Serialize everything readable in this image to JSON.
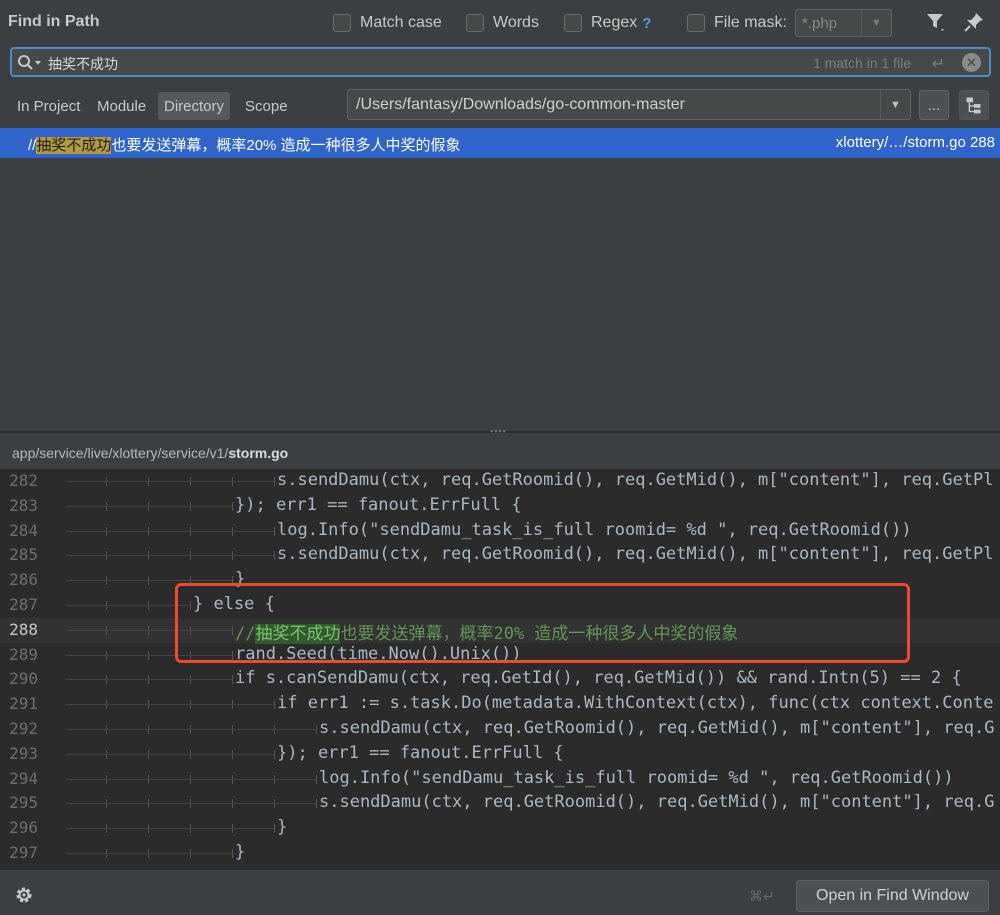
{
  "header": {
    "title": "Find in Path",
    "options": {
      "match_case": "Match case",
      "words": "Words",
      "regex": "Regex",
      "regex_help": "?",
      "file_mask": "File mask:"
    },
    "file_mask_value": "*.php"
  },
  "search": {
    "query": "抽奖不成功",
    "match_count": "1 match in 1 file",
    "enter_glyph": "↵",
    "clear_glyph": "✕"
  },
  "scope": {
    "tabs": [
      "In Project",
      "Module",
      "Directory",
      "Scope"
    ],
    "active": "Directory",
    "directory": "/Users/fantasy/Downloads/go-common-master",
    "browse_label": "..."
  },
  "result": {
    "prefix": "//",
    "match": "抽奖不成功",
    "rest": "也要发送弹幕，概率20% 造成一种很多人中奖的假象",
    "file": "xlottery/…/storm.go 288"
  },
  "preview": {
    "path_prefix": "app/service/live/xlottery/service/v1/",
    "path_file": "storm.go",
    "current_line": "288",
    "lines": [
      {
        "num": "282",
        "code": "s.sendDamu(ctx, req.GetRoomid(), req.GetMid(), m[\"content\"], req.GetPl"
      },
      {
        "num": "283",
        "code": "}); err1 == fanout.ErrFull {"
      },
      {
        "num": "284",
        "code": "log.Info(\"sendDamu_task_is_full roomid= %d \", req.GetRoomid())"
      },
      {
        "num": "285",
        "code": "s.sendDamu(ctx, req.GetRoomid(), req.GetMid(), m[\"content\"], req.GetPl"
      },
      {
        "num": "286",
        "code": "}"
      },
      {
        "num": "287",
        "code": "} else {"
      },
      {
        "num": "288",
        "code_prefix": "//",
        "code_match": "抽奖不成功",
        "code_rest": "也要发送弹幕，概率20% 造成一种很多人中奖的假象"
      },
      {
        "num": "289",
        "code": "rand.Seed(time.Now().Unix())"
      },
      {
        "num": "290",
        "code": "if s.canSendDamu(ctx, req.GetId(), req.GetMid()) && rand.Intn(5) == 2 {"
      },
      {
        "num": "291",
        "code": "if err1 := s.task.Do(metadata.WithContext(ctx), func(ctx context.Conte"
      },
      {
        "num": "292",
        "code": "s.sendDamu(ctx, req.GetRoomid(), req.GetMid(), m[\"content\"], req.G"
      },
      {
        "num": "293",
        "code": "}); err1 == fanout.ErrFull {"
      },
      {
        "num": "294",
        "code": "log.Info(\"sendDamu_task_is_full roomid= %d \", req.GetRoomid())"
      },
      {
        "num": "295",
        "code": "s.sendDamu(ctx, req.GetRoomid(), req.GetMid(), m[\"content\"], req.G"
      },
      {
        "num": "296",
        "code": "}"
      },
      {
        "num": "297",
        "code": "}"
      }
    ]
  },
  "footer": {
    "shortcut": "⌘↵",
    "open_button": "Open in Find Window"
  },
  "colors": {
    "accent": "#2f65ca",
    "annotation": "#f04a2a",
    "match_highlight": "#b49a3c"
  },
  "icons": [
    "search-icon",
    "filter-icon",
    "pin-icon",
    "clear-icon",
    "settings-icon",
    "tree-icon",
    "chevron-down-icon"
  ]
}
